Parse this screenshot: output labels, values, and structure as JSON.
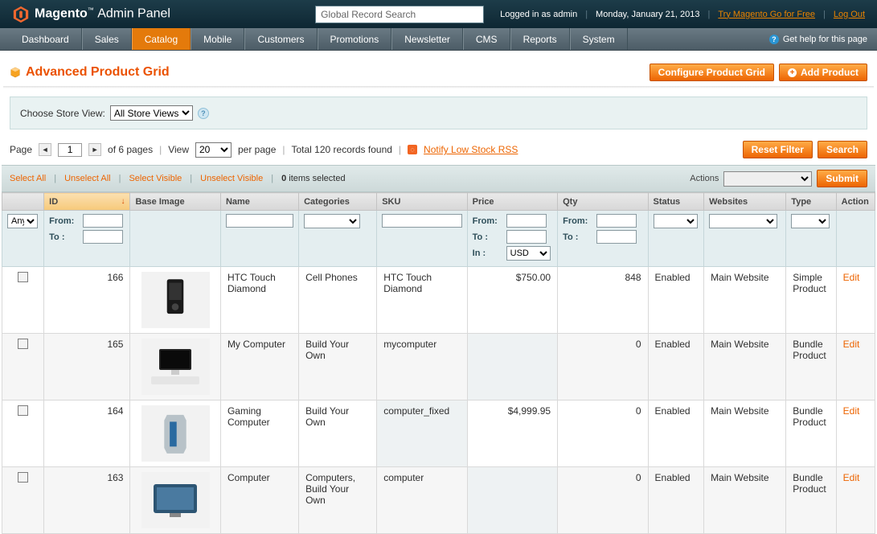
{
  "header": {
    "logo_text_a": "Magento",
    "logo_text_b": "Admin Panel",
    "search_placeholder": "Global Record Search",
    "logged_in": "Logged in as admin",
    "date": "Monday, January 21, 2013",
    "try_link": "Try Magento Go for Free",
    "logout": "Log Out"
  },
  "nav": {
    "items": [
      "Dashboard",
      "Sales",
      "Catalog",
      "Mobile",
      "Customers",
      "Promotions",
      "Newsletter",
      "CMS",
      "Reports",
      "System"
    ],
    "active": "Catalog",
    "help": "Get help for this page"
  },
  "page": {
    "title": "Advanced Product Grid",
    "btn_configure": "Configure Product Grid",
    "btn_add": "Add Product"
  },
  "store": {
    "label": "Choose Store View:",
    "value": "All Store Views"
  },
  "pager": {
    "page_label": "Page",
    "page_value": "1",
    "of_pages": "of 6 pages",
    "view_label": "View",
    "perpage_value": "20",
    "per_page": "per page",
    "total": "Total 120 records found",
    "rss": "Notify Low Stock RSS",
    "reset": "Reset Filter",
    "search": "Search"
  },
  "mass": {
    "select_all": "Select All",
    "unselect_all": "Unselect All",
    "select_visible": "Select Visible",
    "unselect_visible": "Unselect Visible",
    "items_selected": "0 items selected",
    "actions_label": "Actions",
    "submit": "Submit"
  },
  "columns": {
    "id": "ID",
    "base_image": "Base Image",
    "name": "Name",
    "categories": "Categories",
    "sku": "SKU",
    "price": "Price",
    "qty": "Qty",
    "status": "Status",
    "websites": "Websites",
    "type": "Type",
    "action": "Action"
  },
  "filters": {
    "any": "Any",
    "from": "From:",
    "to": "To :",
    "in": "In :",
    "currency": "USD"
  },
  "rows": [
    {
      "id": "166",
      "name": "HTC Touch Diamond",
      "categories": "Cell Phones",
      "sku": "HTC Touch Diamond",
      "price": "$750.00",
      "qty": "848",
      "status": "Enabled",
      "website": "Main Website",
      "type": "Simple Product",
      "action": "Edit"
    },
    {
      "id": "165",
      "name": "My Computer",
      "categories": "Build Your Own",
      "sku": "mycomputer",
      "price": "",
      "qty": "0",
      "status": "Enabled",
      "website": "Main Website",
      "type": "Bundle Product",
      "action": "Edit"
    },
    {
      "id": "164",
      "name": "Gaming Computer",
      "categories": "Build Your Own",
      "sku": "computer_fixed",
      "price": "$4,999.95",
      "qty": "0",
      "status": "Enabled",
      "website": "Main Website",
      "type": "Bundle Product",
      "action": "Edit"
    },
    {
      "id": "163",
      "name": "Computer",
      "categories": "Computers, Build Your Own",
      "sku": "computer",
      "price": "",
      "qty": "0",
      "status": "Enabled",
      "website": "Main Website",
      "type": "Bundle Product",
      "action": "Edit"
    }
  ]
}
